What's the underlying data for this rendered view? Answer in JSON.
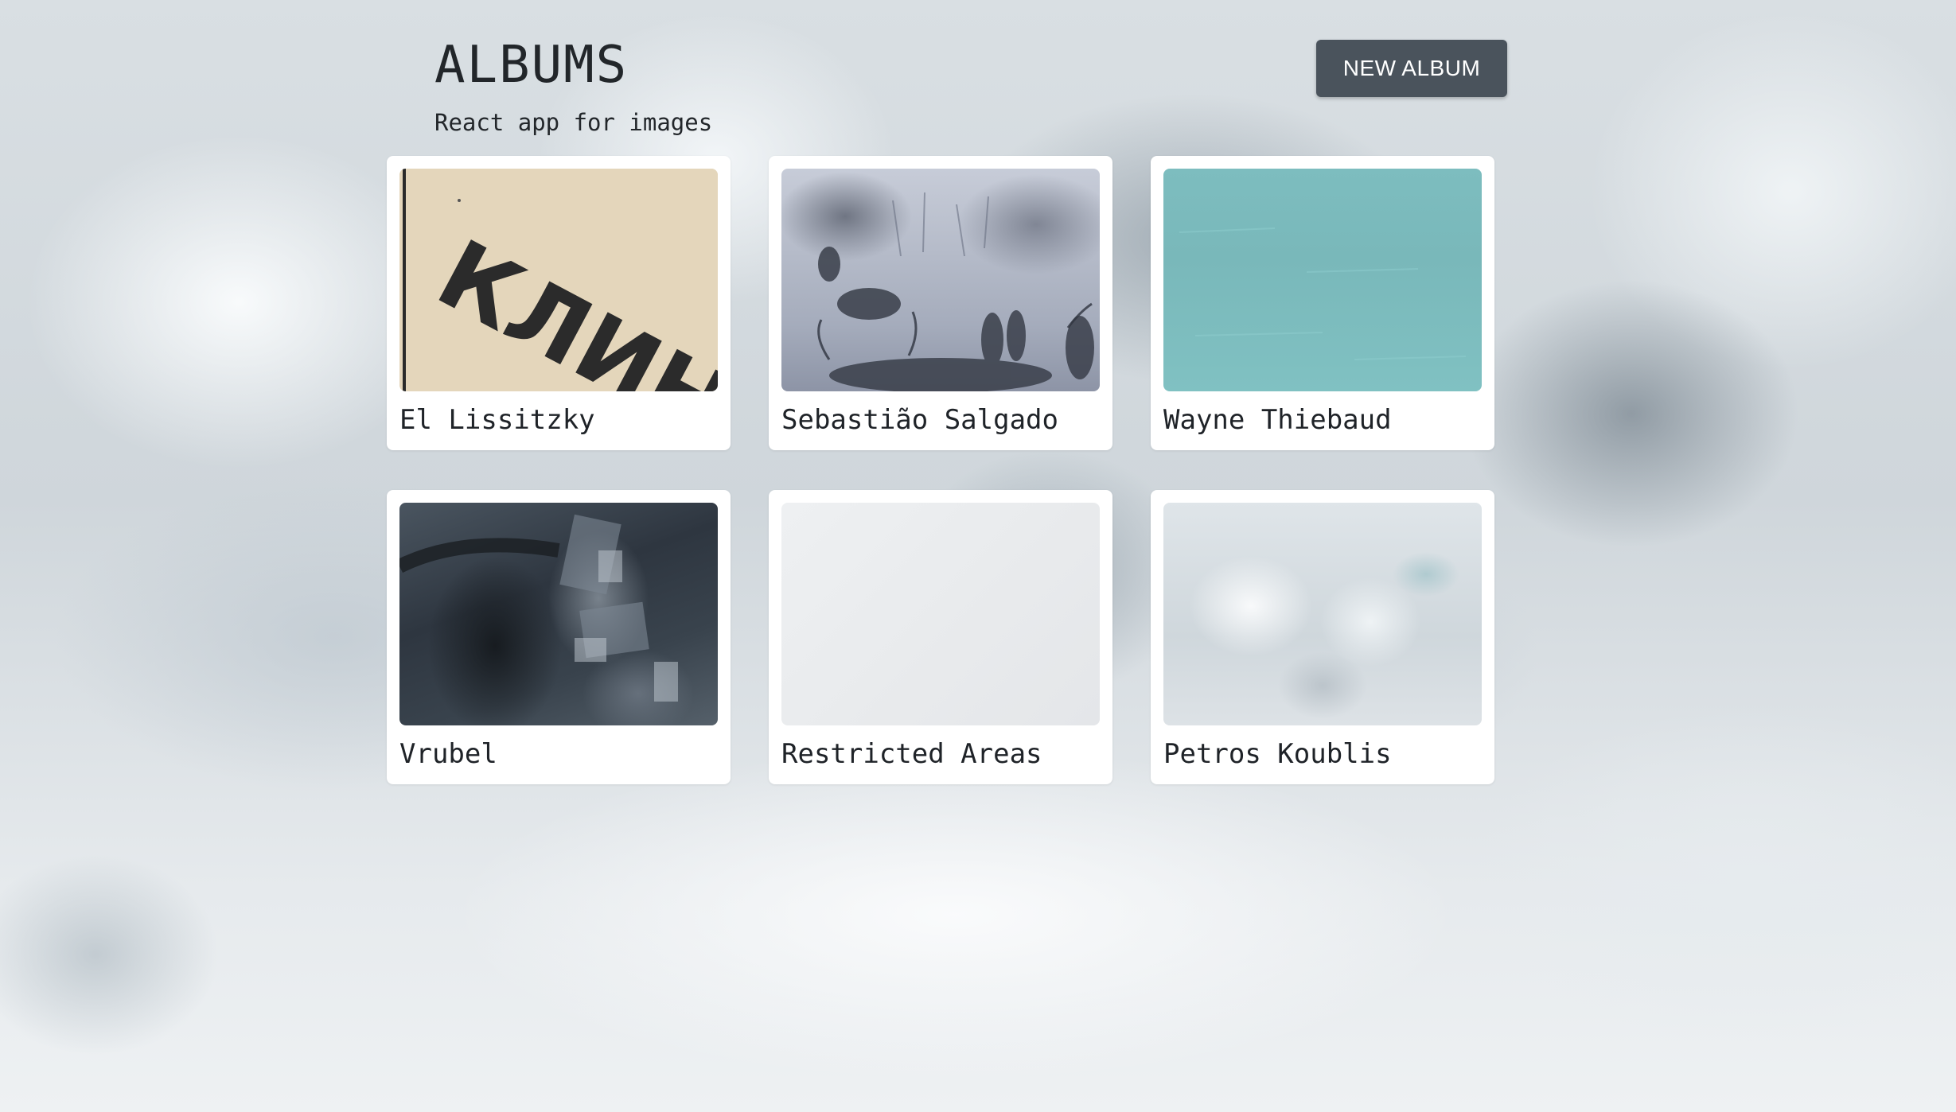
{
  "header": {
    "title": "ALBUMS",
    "subtitle": "React app for images",
    "new_album_label": "NEW ALBUM"
  },
  "albums": [
    {
      "name": "El Lissitzky",
      "cover_text": "КЛИНО"
    },
    {
      "name": "Sebastião Salgado"
    },
    {
      "name": "Wayne Thiebaud"
    },
    {
      "name": "Vrubel"
    },
    {
      "name": "Restricted Areas"
    },
    {
      "name": "Petros Koublis"
    }
  ],
  "colors": {
    "button": "#4a535c",
    "card": "#ffffff",
    "text": "#1f2328"
  }
}
